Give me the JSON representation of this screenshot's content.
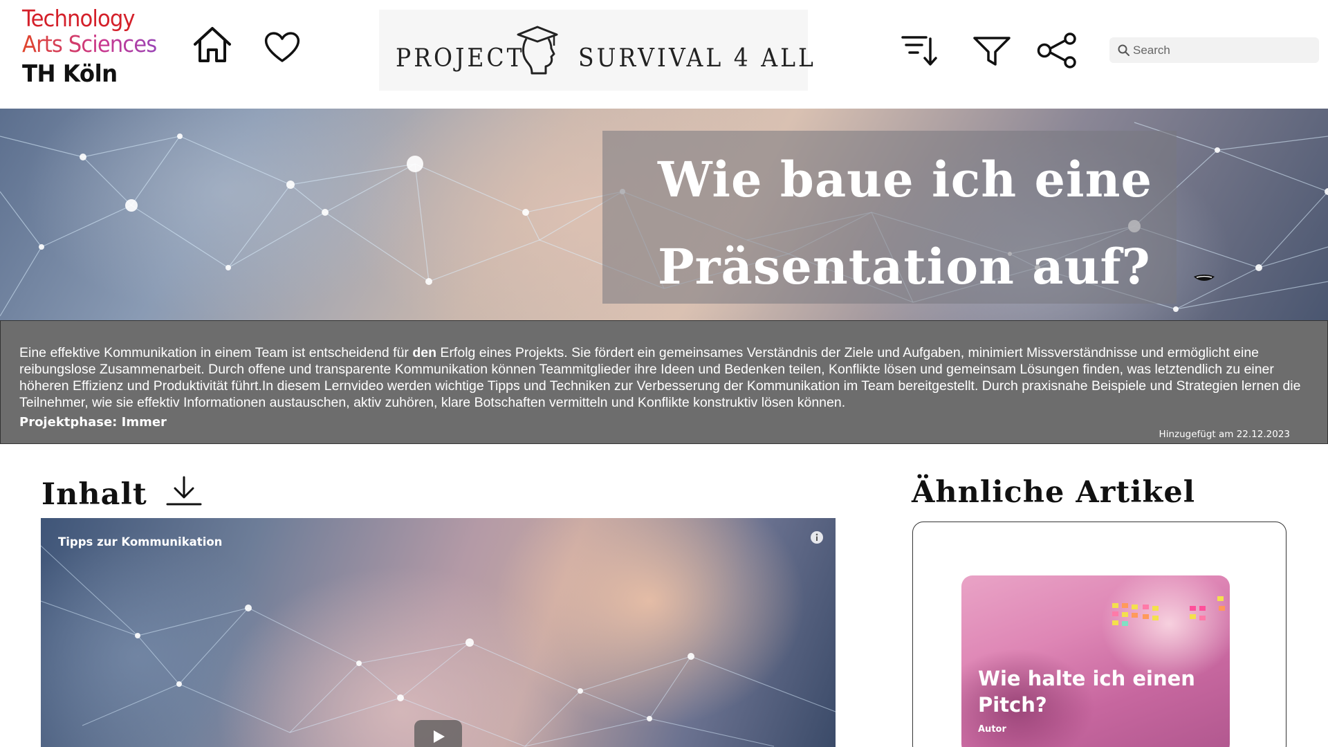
{
  "logo": {
    "line1": "Technology",
    "line2": "Arts Sciences",
    "line3": "TH Köln"
  },
  "header": {
    "icons": [
      "home-icon",
      "heart-icon",
      "sort-icon",
      "filter-icon",
      "share-icon"
    ],
    "project_banner": {
      "left_text": "PROJECT",
      "right_text": "SURVIVAL 4 ALL",
      "icon": "graduate-head-icon"
    },
    "search": {
      "placeholder": "Search"
    }
  },
  "hero": {
    "title": "Wie baue ich eine Präsentation auf?"
  },
  "description": {
    "text_before": "Eine effektive Kommunikation in einem Team ist entscheidend für ",
    "text_bold": "den",
    "text_after": " Erfolg eines Projekts. Sie fördert ein gemeinsames Verständnis der Ziele und Aufgaben, minimiert Missverständnisse und ermöglicht eine reibungslose Zusammenarbeit. Durch offene und transparente Kommunikation können Teammitglieder ihre Ideen und Bedenken teilen, Konflikte lösen und gemeinsam Lösungen finden, was letztendlich zu einer höheren Effizienz und Produktivität führt.In diesem Lernvideo werden wichtige Tipps und Techniken zur Verbesserung der Kommunikation im Team bereitgestellt. Durch praxisnahe Beispiele und Strategien lernen die Teilnehmer, wie sie effektiv Informationen austauschen, aktiv zuhören, klare Botschaften vermitteln und Konflikte konstruktiv lösen können.",
    "phase": "Projektphase: Immer",
    "date": "Hinzugefügt am 22.12.2023"
  },
  "content": {
    "title": "Inhalt",
    "video_title": "Tipps zur Kommunikation"
  },
  "related": {
    "title": "Ähnliche Artikel",
    "cards": [
      {
        "title": "Wie halte ich einen Pitch?",
        "author": "Autor"
      }
    ]
  },
  "colors": {
    "logo_red": "#d4202a",
    "desc_background": "#6d6d6d",
    "related_card_pink": "#de86b5"
  }
}
